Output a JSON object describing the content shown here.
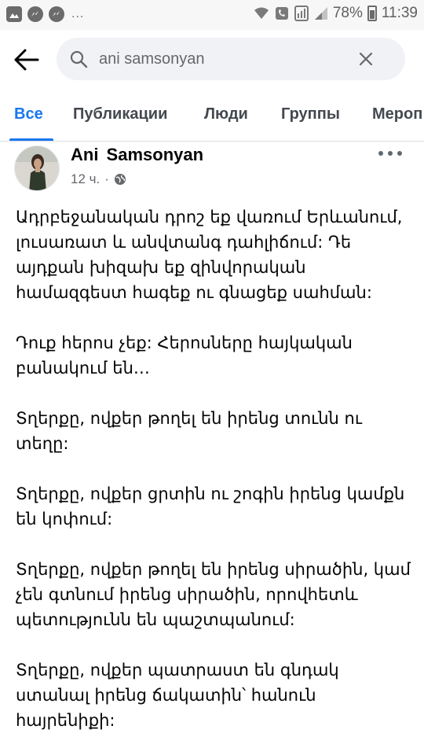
{
  "status_bar": {
    "battery_text": "78%",
    "time": "11:39",
    "more_notifications": "..."
  },
  "search": {
    "query": "ani samsonyan",
    "placeholder": "Search"
  },
  "tabs": [
    {
      "label": "Все",
      "active": true
    },
    {
      "label": "Публикации",
      "active": false
    },
    {
      "label": "Люди",
      "active": false
    },
    {
      "label": "Группы",
      "active": false
    },
    {
      "label": "Мероп",
      "active": false
    }
  ],
  "post": {
    "author": "Ani Samsonyan",
    "time_ago": "12 ч.",
    "separator": "·",
    "privacy_icon": "globe-icon",
    "paragraphs": [
      "Ադրբեջանական դրոշ եք վառում Երևանում, լուսառատ և անվտանգ դահլիճում: Դե այդքան խիզախ եք զինվորական համազգեստ հագեք ու գնացեք սահման:",
      "Դուք հերոս չեք: Հերոսները հայկական բանակում են…",
      "Տղերքը, ովքեր թողել են իրենց տունն ու տեղը:",
      "Տղերքը, ովքեր ցրտին ու շոգին իրենց կամքն են կոփում:",
      "Տղերքը, ովքեր թողել են իրենց սիրածին, կամ չեն գտնում իրենց սիրածին, որովհետև պետությունն են պաշտպանում:",
      "Տղերքը, ովքեր պատրաստ են գնդակ ստանալ իրենց ճակատին՝ հանուն հայրենիքի:"
    ]
  },
  "colors": {
    "accent": "#1877f2",
    "text": "#050505",
    "secondary_text": "#65676b",
    "search_bg": "#f0f2f5"
  }
}
